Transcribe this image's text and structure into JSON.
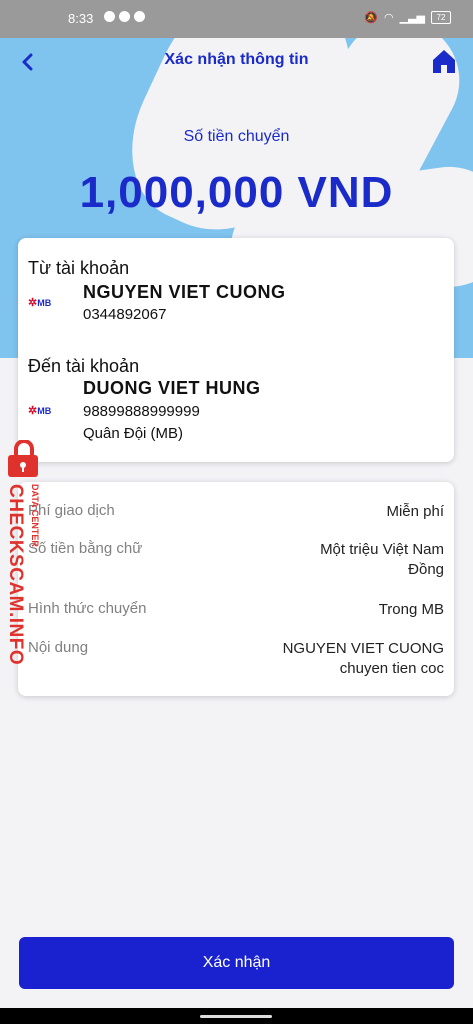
{
  "status_bar": {
    "time": "8:33",
    "battery": "72"
  },
  "header": {
    "title": "Xác nhận thông tin"
  },
  "amount": {
    "label": "Số tiền chuyển",
    "value": "1,000,000 VND"
  },
  "from": {
    "label": "Từ tài khoản",
    "bank_logo": "MB",
    "name": "NGUYEN VIET CUONG",
    "number": "0344892067"
  },
  "to": {
    "label": "Đến tài khoản",
    "bank_logo": "MB",
    "name": "DUONG VIET HUNG",
    "number": "98899888999999",
    "bank": "Quân Đội (MB)"
  },
  "details": [
    {
      "key": "Phí giao dịch",
      "value_lines": [
        "Miễn phí"
      ]
    },
    {
      "key": "Số tiền bằng chữ",
      "value_lines": [
        "Một triệu Việt Nam",
        "Đồng"
      ]
    },
    {
      "key": "Hình thức chuyển",
      "value_lines": [
        "Trong MB"
      ]
    },
    {
      "key": "Nội dung",
      "value_lines": [
        "NGUYEN VIET CUONG",
        "chuyen tien coc"
      ]
    }
  ],
  "watermark": {
    "text_main": "CHECKSCAM.INFO",
    "text_sub": "DATA CENTER"
  },
  "confirm_button": {
    "label": "Xác nhận"
  },
  "colors": {
    "primary": "#1a2bc9",
    "hero_bg": "#7fc3ef",
    "button": "#1a22cf",
    "watermark": "#e0322d"
  }
}
